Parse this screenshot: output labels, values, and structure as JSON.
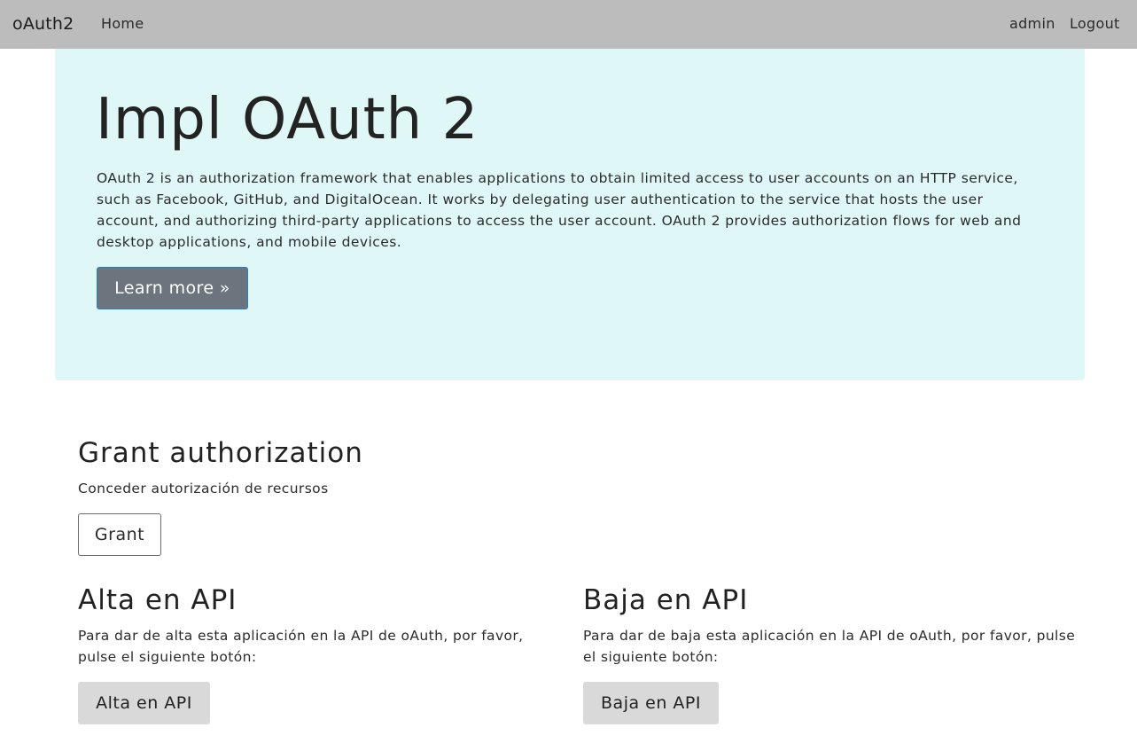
{
  "navbar": {
    "brand": "oAuth2",
    "home": "Home",
    "user": "admin",
    "logout": "Logout"
  },
  "jumbotron": {
    "title": "Impl OAuth 2",
    "lead": "OAuth 2 is an authorization framework that enables applications to obtain limited access to user accounts on an HTTP service, such as Facebook, GitHub, and DigitalOcean. It works by delegating user authentication to the service that hosts the user account, and authorizing third-party applications to access the user account. OAuth 2 provides authorization flows for web and desktop applications, and mobile devices.",
    "button_label": "Learn more »"
  },
  "grant": {
    "title": "Grant authorization",
    "text": "Conceder autorización de recursos",
    "button_label": "Grant"
  },
  "alta": {
    "title": "Alta en API",
    "text": "Para dar de alta esta aplicación en la API de oAuth, por favor, pulse el siguiente botón:",
    "button_label": "Alta en API"
  },
  "baja": {
    "title": "Baja en API",
    "text": "Para dar de baja esta aplicación en la API de oAuth, por favor, pulse el siguiente botón:",
    "button_label": "Baja en API"
  },
  "colors": {
    "navbar_bg": "#bcbcbc",
    "jumbotron_bg": "#dff7f7",
    "primary_button_bg": "#6c757d",
    "secondary_button_bg": "#d9d9d9"
  }
}
